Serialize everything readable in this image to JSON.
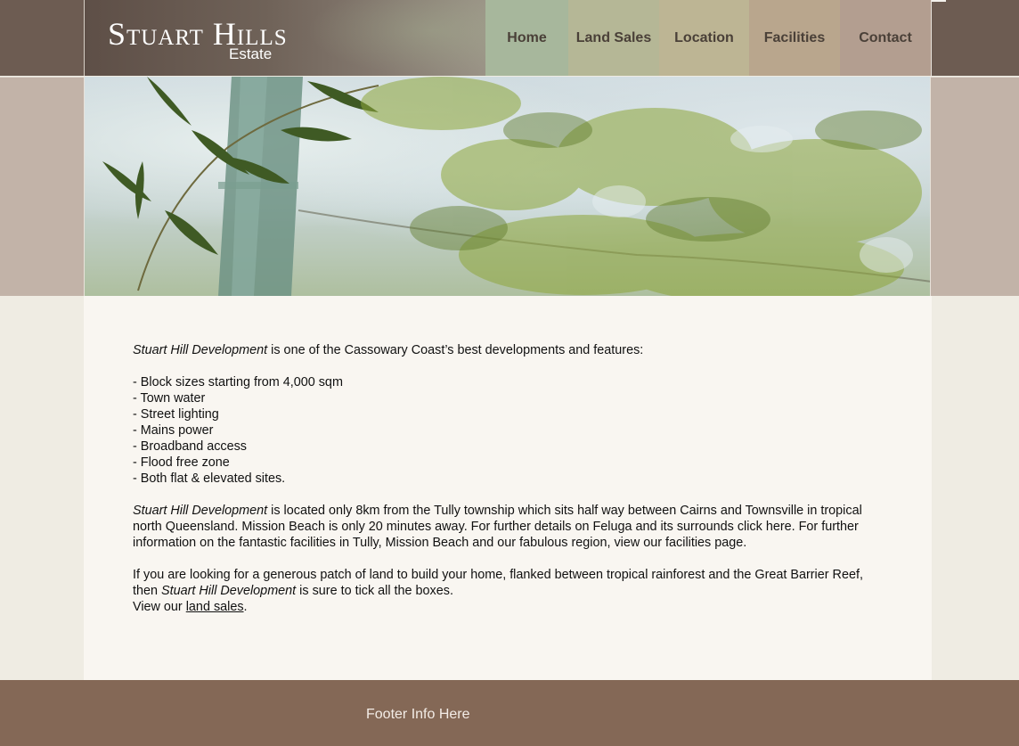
{
  "header": {
    "logo_title": "Stuart Hills",
    "logo_subtitle": "Estate"
  },
  "nav": {
    "items": [
      {
        "label": "Home",
        "color": "#a7b79c"
      },
      {
        "label": "Land Sales",
        "color": "#b5b796"
      },
      {
        "label": "Location",
        "color": "#bdb594"
      },
      {
        "label": "Facilities",
        "color": "#b9a68d"
      },
      {
        "label": "Contact",
        "color": "#b39e90"
      }
    ]
  },
  "hero": {
    "image_subject": "bamboo-leaves-photo"
  },
  "content": {
    "intro_em": "Stuart Hill Development",
    "intro_rest": " is one of the Cassowary Coast’s best developments and features:",
    "features": [
      "- Block sizes starting from 4,000 sqm",
      "- Town water",
      "- Street lighting",
      "- Mains power",
      "- Broadband access",
      "- Flood free zone",
      "- Both flat & elevated sites."
    ],
    "location_em": "Stuart Hill Development",
    "location_rest": " is located only 8km from the Tully township which sits half way between Cairns and Townsville in tropical north Queensland.  Mission Beach is only 20 minutes away. For further details on Feluga and its surrounds click here.  For further information on the fantastic facilities in Tully, Mission Beach and our fabulous region, view our facilities page.",
    "closing_pre": "If you are looking for a generous patch of land to build your home, flanked between tropical rainforest and the Great Barrier Reef, then ",
    "closing_em": "Stuart Hill Development",
    "closing_post": " is sure to tick all the boxes.",
    "view_pre": "View our ",
    "view_link": "land sales",
    "view_post": "."
  },
  "footer": {
    "text": "Footer Info Here"
  },
  "colors": {
    "header_band": "#6d5c52",
    "hero_band": "#c2b3a8",
    "content_bg": "#f9f6f1",
    "page_bg": "#efece3",
    "footer_bg": "#846856"
  }
}
